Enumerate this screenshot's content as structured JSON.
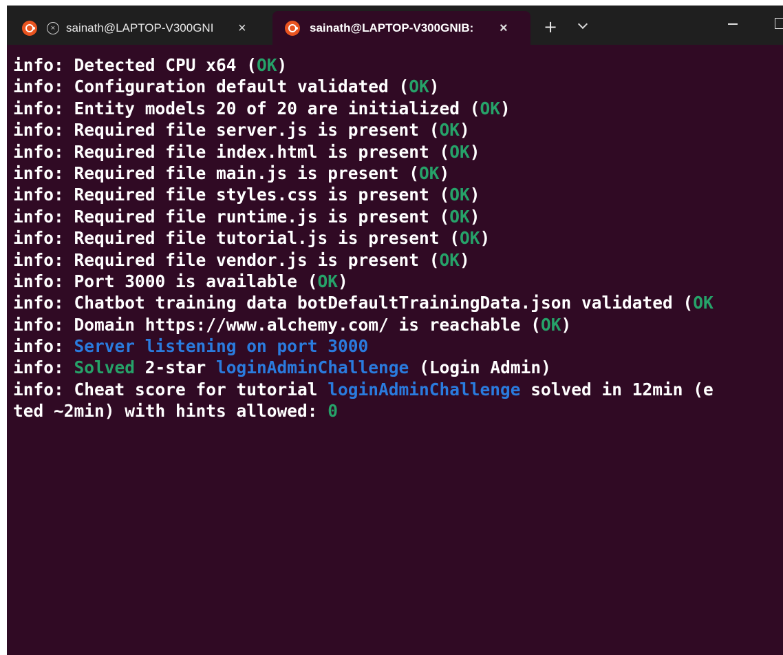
{
  "tabs": [
    {
      "title": "sainath@LAPTOP-V300GNI",
      "close": "×"
    },
    {
      "title": "sainath@LAPTOP-V300GNIB:",
      "close": "×"
    }
  ],
  "controls": {
    "new_tab": "+",
    "cancel_glyph": "×"
  },
  "colors": {
    "background": "#300a24",
    "ok": "#26a269",
    "highlight": "#2a7bde",
    "tab_icon": "#e95420"
  },
  "terminal": {
    "lines": [
      {
        "pre": "info: Detected CPU x64 (",
        "ok": "OK",
        "post": ")"
      },
      {
        "pre": "info: Configuration default validated (",
        "ok": "OK",
        "post": ")"
      },
      {
        "pre": "info: Entity models 20 of 20 are initialized (",
        "ok": "OK",
        "post": ")"
      },
      {
        "pre": "info: Required file server.js is present (",
        "ok": "OK",
        "post": ")"
      },
      {
        "pre": "info: Required file index.html is present (",
        "ok": "OK",
        "post": ")"
      },
      {
        "pre": "info: Required file main.js is present (",
        "ok": "OK",
        "post": ")"
      },
      {
        "pre": "info: Required file styles.css is present (",
        "ok": "OK",
        "post": ")"
      },
      {
        "pre": "info: Required file runtime.js is present (",
        "ok": "OK",
        "post": ")"
      },
      {
        "pre": "info: Required file tutorial.js is present (",
        "ok": "OK",
        "post": ")"
      },
      {
        "pre": "info: Required file vendor.js is present (",
        "ok": "OK",
        "post": ")"
      },
      {
        "pre": "info: Port 3000 is available (",
        "ok": "OK",
        "post": ")"
      },
      {
        "pre": "info: Chatbot training data botDefaultTrainingData.json validated (",
        "ok": "OK",
        "post": ""
      },
      {
        "pre": "info: Domain https://www.alchemy.com/ is reachable (",
        "ok": "OK",
        "post": ")"
      }
    ],
    "server_line": {
      "prefix": "info: ",
      "message": "Server listening on port 3000"
    },
    "solved_line": {
      "prefix": "info: ",
      "solved": "Solved",
      "mid": " 2-star ",
      "challenge": "loginAdminChallenge",
      "post": " (Login Admin)"
    },
    "cheat_line": {
      "pre": "info: Cheat score for tutorial ",
      "challenge": "loginAdminChallenge",
      "post": " solved in 12min (e"
    },
    "cheat_line2": {
      "pre": "ted ~2min) with hints allowed: ",
      "value": "0"
    }
  }
}
